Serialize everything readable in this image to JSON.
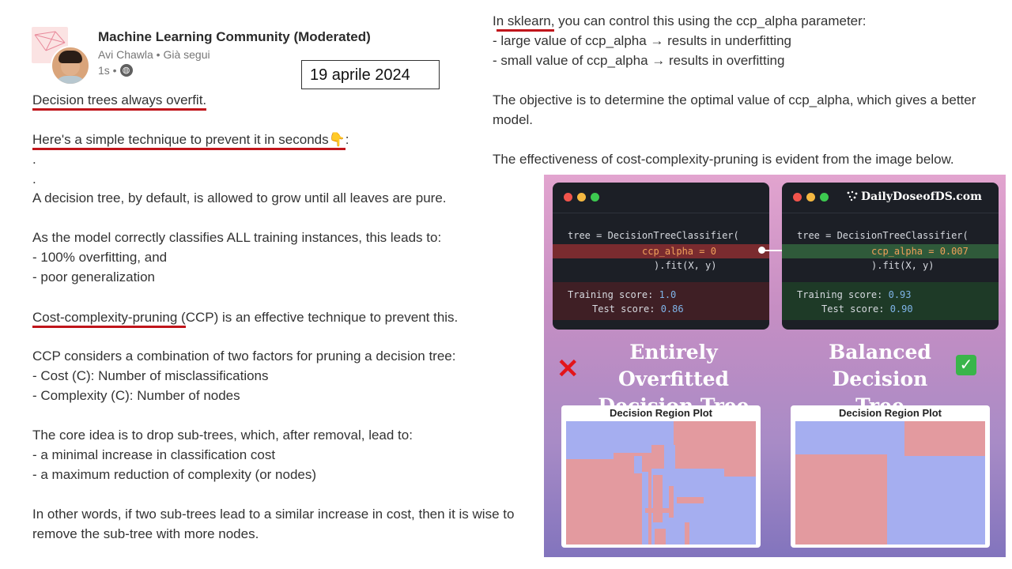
{
  "header": {
    "community": "Machine Learning Community (Moderated)",
    "author_line": "Avi Chawla • Già segui",
    "time": "1s •",
    "date_box": "19 aprile 2024"
  },
  "post_left": [
    {
      "pre": "",
      "u": "Decision trees always overfit.",
      "post": ""
    },
    {
      "pre": "",
      "u": "Here's a simple technique to prevent it in seconds👇",
      "post": ":"
    },
    {
      "pre": ".",
      "u": "",
      "post": ""
    },
    {
      "pre": ".",
      "u": "",
      "post": ""
    },
    {
      "pre": "A decision tree, by default, is allowed to grow until all leaves are pure.",
      "u": "",
      "post": ""
    },
    {
      "pre": "As the model correctly classifies ALL training instances, this leads to:",
      "u": "",
      "post": ""
    },
    {
      "pre": "- 100% overfitting, and",
      "u": "",
      "post": ""
    },
    {
      "pre": "- poor generalization",
      "u": "",
      "post": ""
    },
    {
      "pre": "",
      "u": "Cost-complexity-pruning (",
      "post": "CCP) is an effective technique to prevent this."
    },
    {
      "pre": "CCP considers a combination of two factors for pruning a decision tree:",
      "u": "",
      "post": ""
    },
    {
      "pre": "- Cost (C): Number of misclassifications",
      "u": "",
      "post": ""
    },
    {
      "pre": "- Complexity (C): Number of nodes",
      "u": "",
      "post": ""
    },
    {
      "pre": "The core idea is to drop sub-trees, which, after removal, lead to:",
      "u": "",
      "post": ""
    },
    {
      "pre": "- a minimal increase in classification cost",
      "u": "",
      "post": ""
    },
    {
      "pre": "- a maximum reduction of complexity (or nodes)",
      "u": "",
      "post": ""
    },
    {
      "pre": "In other words, if two sub-trees lead to a similar increase in cost, then it is wise to",
      "u": "",
      "post": ""
    },
    {
      "pre": "remove the sub-tree with more nodes.",
      "u": "",
      "post": ""
    }
  ],
  "post_right": [
    {
      "pre": "I",
      "u": "n sklearn,",
      "post": " you can control this using the ccp_alpha parameter:"
    },
    {
      "pre": "- large value of ccp_alpha → results in underfitting",
      "u": "",
      "post": ""
    },
    {
      "pre": "- small value of ccp_alpha → results in overfitting",
      "u": "",
      "post": ""
    },
    {
      "pre": "The objective is to determine the optimal value of ccp_alpha, which gives a better",
      "u": "",
      "post": ""
    },
    {
      "pre": "model.",
      "u": "",
      "post": ""
    },
    {
      "pre": "The effectiveness of cost-complexity-pruning is evident from the image below.",
      "u": "",
      "post": ""
    }
  ],
  "infographic": {
    "brand": "DailyDoseofDS.com",
    "left_panel": {
      "code_l1": "tree = DecisionTreeClassifier(",
      "code_l2_kw": "ccp_alpha = ",
      "code_l2_val": "0",
      "code_l3": ").fit(X, y)",
      "train_label": "Training score: ",
      "train_val": "1.0",
      "test_label": "Test score: ",
      "test_val": "0.86"
    },
    "right_panel": {
      "code_l1": "tree = DecisionTreeClassifier(",
      "code_l2_kw": "ccp_alpha = ",
      "code_l2_val": "0.007",
      "code_l3": ").fit(X, y)",
      "train_label": "Training score: ",
      "train_val": "0.93",
      "test_label": "Test score: ",
      "test_val": "0.90"
    },
    "left_title_1": "Entirely Overfitted",
    "left_title_2": "Decision Tree",
    "right_title_1": "Balanced",
    "right_title_2": "Decision Tree",
    "plot_title": "Decision Region Plot",
    "icons": {
      "left": "cross-mark-icon",
      "right": "check-mark-icon"
    },
    "colors": {
      "red_region": "#e39a9f",
      "blue_region": "#a5aef0",
      "code_red_bg": "#7a2b2f",
      "code_green_bg": "#2f5a3a"
    }
  }
}
